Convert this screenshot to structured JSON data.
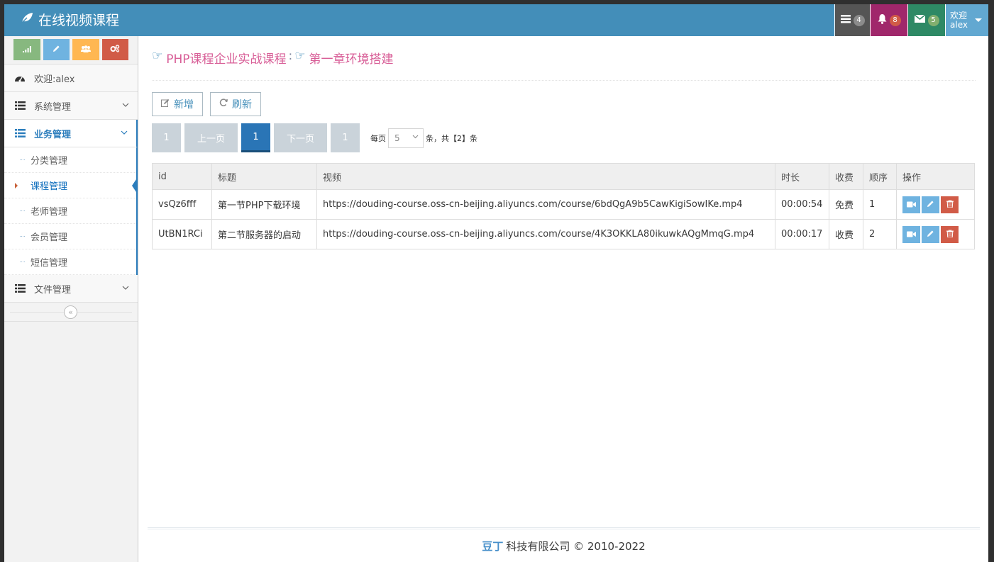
{
  "navbar": {
    "brand": "在线视频课程",
    "tasks_count": "4",
    "notifications_count": "8",
    "messages_count": "5",
    "user_greeting": "欢迎",
    "user_name": "alex",
    "colors": {
      "bar": "#438eb9",
      "tasks": "#555555",
      "notifications": "#a0276b",
      "messages": "#2e8965",
      "user": "#62a8d1"
    }
  },
  "sidebar": {
    "welcome": "欢迎:alex",
    "menu": [
      {
        "label": "系统管理",
        "icon": "list-icon"
      },
      {
        "label": "业务管理",
        "icon": "list-icon"
      },
      {
        "label": "文件管理",
        "icon": "list-icon"
      }
    ],
    "submenu": [
      "分类管理",
      "课程管理",
      "老师管理",
      "会员管理",
      "短信管理"
    ],
    "collapse_glyph": "«"
  },
  "breadcrumb": {
    "course": "PHP课程企业实战课程",
    "separator": ":",
    "chapter": "第一章环境搭建"
  },
  "toolbar": {
    "add_label": "新增",
    "refresh_label": "刷新"
  },
  "pager": {
    "first": "1",
    "prev": "上一页",
    "current": "1",
    "next": "下一页",
    "last": "1",
    "per_page_prefix": "每页",
    "per_page_value": "5",
    "total_text": "条，共【2】条"
  },
  "table": {
    "headers": [
      "id",
      "标题",
      "视频",
      "时长",
      "收费",
      "顺序",
      "操作"
    ],
    "rows": [
      {
        "id": "vsQz6fff",
        "title": "第一节PHP下载环境",
        "video": "https://douding-course.oss-cn-beijing.aliyuncs.com/course/6bdQgA9b5CawKigiSowIKe.mp4",
        "duration": "00:00:54",
        "charge": "免费",
        "order": "1"
      },
      {
        "id": "UtBN1RCi",
        "title": "第二节服务器的启动",
        "video": "https://douding-course.oss-cn-beijing.aliyuncs.com/course/4K3OKKLA80ikuwkAQgMmqG.mp4",
        "duration": "00:00:17",
        "charge": "收费",
        "order": "2"
      }
    ]
  },
  "footer": {
    "brand": "豆丁",
    "text": "科技有限公司 © 2010-2022"
  }
}
